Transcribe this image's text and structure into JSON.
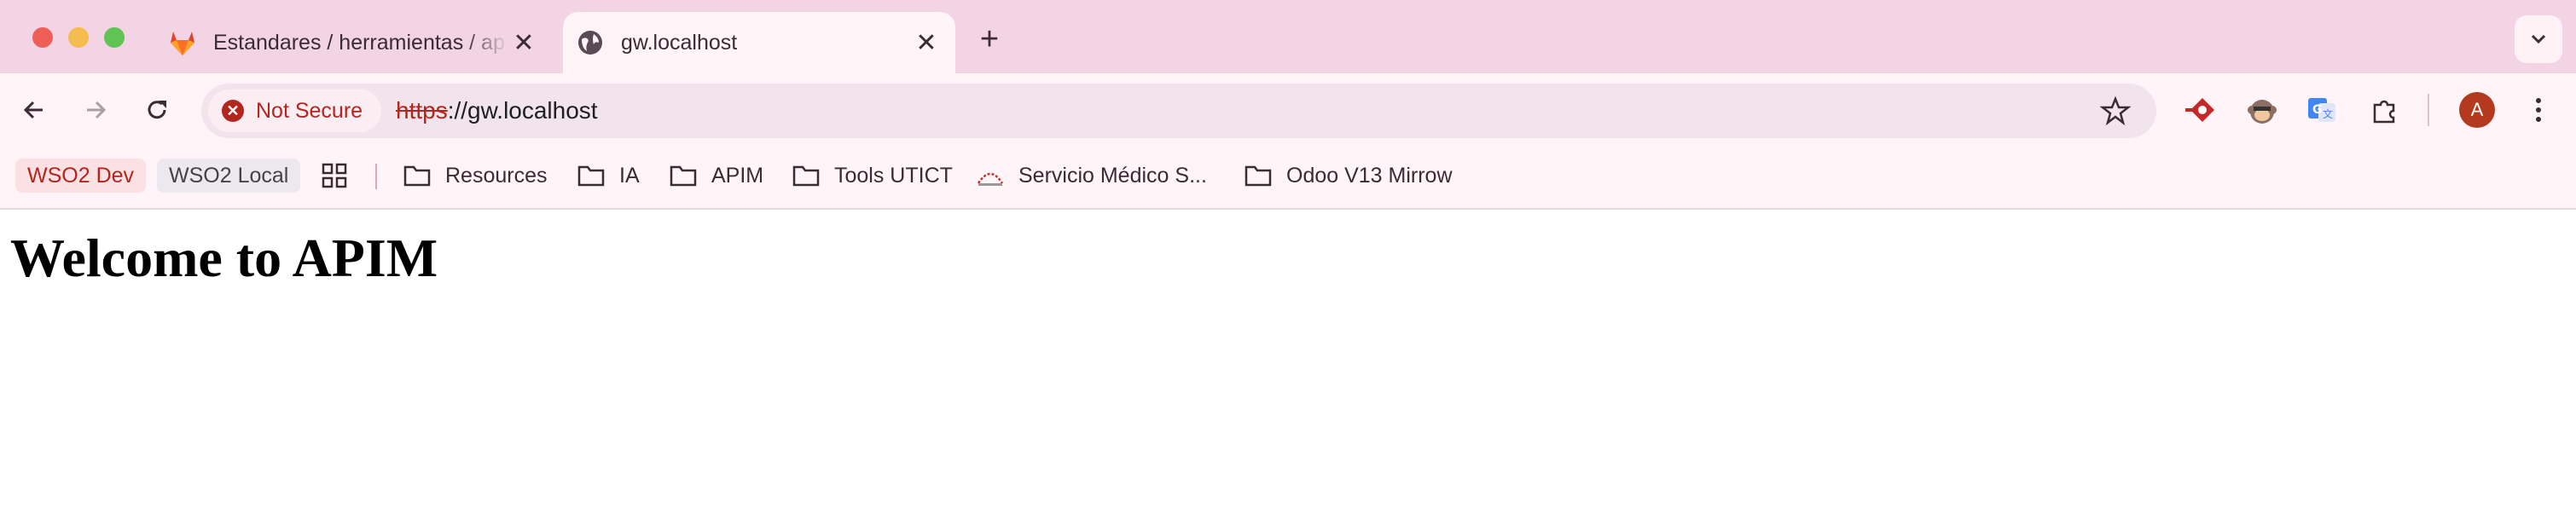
{
  "window": {
    "controls": [
      "close",
      "minimize",
      "zoom"
    ]
  },
  "tabs": [
    {
      "title": "Estandares / herramientas / ap",
      "icon": "gitlab-icon",
      "active": false
    },
    {
      "title": "gw.localhost",
      "icon": "globe-icon",
      "active": true
    }
  ],
  "toolbar": {
    "security_label": "Not Secure",
    "url_scheme": "https",
    "url_rest": "://gw.localhost"
  },
  "profile": {
    "initial": "A"
  },
  "bookmarks": [
    {
      "label": "WSO2 Dev",
      "type": "pill",
      "color": "#b3261e"
    },
    {
      "label": "WSO2 Local",
      "type": "pill"
    },
    {
      "label": "Resources",
      "type": "folder"
    },
    {
      "label": "IA",
      "type": "folder"
    },
    {
      "label": "APIM",
      "type": "folder"
    },
    {
      "label": "Tools UTICT",
      "type": "folder"
    },
    {
      "label": "Servicio Médico S...",
      "type": "site"
    },
    {
      "label": "Odoo V13 Mirrow",
      "type": "folder"
    }
  ],
  "page": {
    "heading": "Welcome to APIM"
  },
  "colors": {
    "tabstrip_bg": "#f2d4e5",
    "toolbar_bg": "#fff4f8",
    "warning": "#b3261e"
  }
}
